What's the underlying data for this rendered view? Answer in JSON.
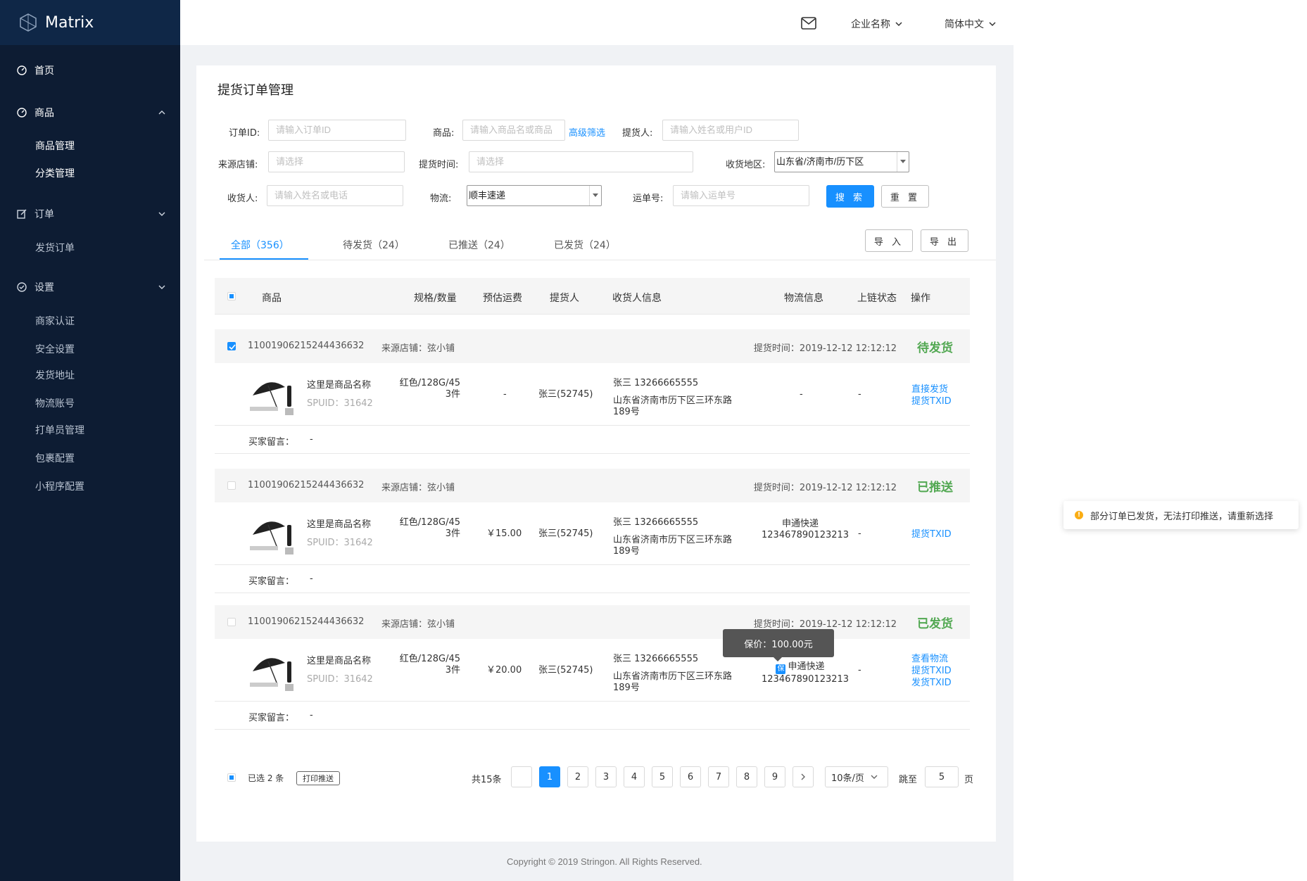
{
  "app": {
    "name": "Matrix"
  },
  "sidebar": {
    "home": "首页",
    "goods": {
      "label": "商品",
      "items": [
        "商品管理",
        "分类管理"
      ]
    },
    "orders": {
      "label": "订单",
      "items": [
        "发货订单"
      ]
    },
    "settings": {
      "label": "设置",
      "items": [
        "商家认证",
        "安全设置",
        "发货地址",
        "物流账号",
        "打单员管理",
        "包裹配置",
        "小程序配置"
      ]
    }
  },
  "topbar": {
    "company": "企业名称",
    "language": "简体中文"
  },
  "page": {
    "title": "提货订单管理"
  },
  "filters": {
    "order_id": {
      "label": "订单ID:",
      "placeholder": "请输入订单ID"
    },
    "goods": {
      "label": "商品:",
      "placeholder": "请输入商品名或商品",
      "advanced": "高级筛选"
    },
    "picker": {
      "label": "提货人:",
      "placeholder": "请输入姓名或用户ID"
    },
    "store": {
      "label": "来源店铺:",
      "placeholder": "请选择"
    },
    "pick_time": {
      "label": "提货时间:",
      "placeholder": "请选择"
    },
    "region": {
      "label": "收货地区:",
      "value": "山东省/济南市/历下区"
    },
    "receiver": {
      "label": "收货人:",
      "placeholder": "请输入姓名或电话"
    },
    "logistics": {
      "label": "物流:",
      "value": "顺丰速递"
    },
    "tracking": {
      "label": "运单号:",
      "placeholder": "请输入运单号"
    },
    "search_btn": "搜 索",
    "reset_btn": "重 置"
  },
  "actions": {
    "import": "导 入",
    "export": "导 出"
  },
  "tabs": [
    "全部（356）",
    "待发货（24）",
    "已推送（24）",
    "已发货（24）"
  ],
  "table": {
    "columns": [
      "商品",
      "规格/数量",
      "预估运费",
      "提货人",
      "收货人信息",
      "物流信息",
      "上链状态",
      "操作"
    ]
  },
  "orders": [
    {
      "id": "11001906215244436632",
      "store": "来源店铺：弦小铺",
      "time": "提货时间：2019-12-12  12:12:12",
      "status": "待发货",
      "product": "这里是商品名称",
      "spuid": "SPUID：31642",
      "spec": "红色/128G/45",
      "qty": "3件",
      "freight": "-",
      "picker": "张三(52745)",
      "receiver": "张三  13266665555",
      "addr1": "山东省济南市历下区三环东路",
      "addr2": "189号",
      "logistics1": "-",
      "logistics2": "",
      "chain": "-",
      "ops": [
        "直接发货",
        "提货TXID"
      ],
      "msg_label": "买家留言：",
      "msg": "-"
    },
    {
      "id": "11001906215244436632",
      "store": "来源店铺：弦小铺",
      "time": "提货时间：2019-12-12  12:12:12",
      "status": "已推送",
      "product": "这里是商品名称",
      "spuid": "SPUID：31642",
      "spec": "红色/128G/45",
      "qty": "3件",
      "freight": "￥15.00",
      "picker": "张三(52745)",
      "receiver": "张三  13266665555",
      "addr1": "山东省济南市历下区三环东路",
      "addr2": "189号",
      "logistics1": "申通快递",
      "logistics2": "123467890123213",
      "chain": "-",
      "ops": [
        "提货TXID"
      ],
      "msg_label": "买家留言：",
      "msg": "-"
    },
    {
      "id": "11001906215244436632",
      "store": "来源店铺：弦小铺",
      "time": "提货时间：2019-12-12  12:12:12",
      "status": "已发货",
      "product": "这里是商品名称",
      "spuid": "SPUID：31642",
      "spec": "红色/128G/45",
      "qty": "3件",
      "freight": "￥20.00",
      "picker": "张三(52745)",
      "receiver": "张三  13266665555",
      "addr1": "山东省济南市历下区三环东路",
      "addr2": "189号",
      "logistics1": "申通快递",
      "logistics2": "123467890123213",
      "chain": "-",
      "ops": [
        "查看物流",
        "提货TXID",
        "发货TXID"
      ],
      "msg_label": "买家留言：",
      "msg": "-",
      "insure_badge": "保",
      "tooltip": "保价：100.00元"
    }
  ],
  "footer": {
    "selected": "已选 2 条",
    "print": "打印推送",
    "total": "共15条",
    "pages": [
      "1",
      "2",
      "3",
      "4",
      "5",
      "6",
      "7",
      "8",
      "9"
    ],
    "current_page": "1",
    "page_size": "10条/页",
    "jump_label": "跳至",
    "jump_value": "5",
    "page_unit": "页"
  },
  "toast": {
    "text": "部分订单已发货，无法打印推送，请重新选择"
  },
  "copyright": "Copyright © 2019 Stringon. All Rights Reserved.",
  "colors": {
    "primary": "#1890ff",
    "sidebar": "#0d1c33",
    "status_green": "#52a852",
    "warning": "#faad14"
  }
}
